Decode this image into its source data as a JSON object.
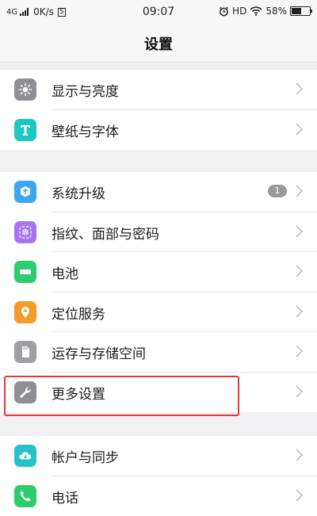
{
  "status_bar": {
    "network": "4G",
    "speed": "0K/s",
    "sim_badge": "S",
    "time": "09:07",
    "hd": "HD",
    "battery_text": "58%",
    "battery_level": 0.58,
    "icons": [
      "signal-icon",
      "alarm-icon",
      "wifi-icon",
      "battery-icon"
    ]
  },
  "nav": {
    "title": "设置"
  },
  "groups": [
    {
      "items": [
        {
          "label": "显示与亮度",
          "icon": "brightness-icon",
          "color": "#8e8e93"
        },
        {
          "label": "壁纸与字体",
          "icon": "font-t-icon",
          "color": "#1cc7c0"
        }
      ]
    },
    {
      "items": [
        {
          "label": "系统升级",
          "icon": "system-update-icon",
          "color": "#3aa7f0",
          "badge": "1"
        },
        {
          "label": "指纹、面部与密码",
          "icon": "fingerprint-icon",
          "color": "#a774f0"
        },
        {
          "label": "电池",
          "icon": "battery-icon",
          "color": "#2ccd6d"
        },
        {
          "label": "定位服务",
          "icon": "location-pin-icon",
          "color": "#f59b2a"
        },
        {
          "label": "运存与存储空间",
          "icon": "sd-card-icon",
          "color": "#9e9ea4"
        },
        {
          "label": "更多设置",
          "icon": "wrench-icon",
          "color": "#8e8e93"
        }
      ]
    },
    {
      "items": [
        {
          "label": "帐户与同步",
          "icon": "cloud-sync-icon",
          "color": "#25c3c8"
        },
        {
          "label": "电话",
          "icon": "phone-icon",
          "color": "#2ccd6d"
        }
      ]
    }
  ],
  "colors": {
    "highlight": "#e53935",
    "background": "#f0f0f2"
  }
}
